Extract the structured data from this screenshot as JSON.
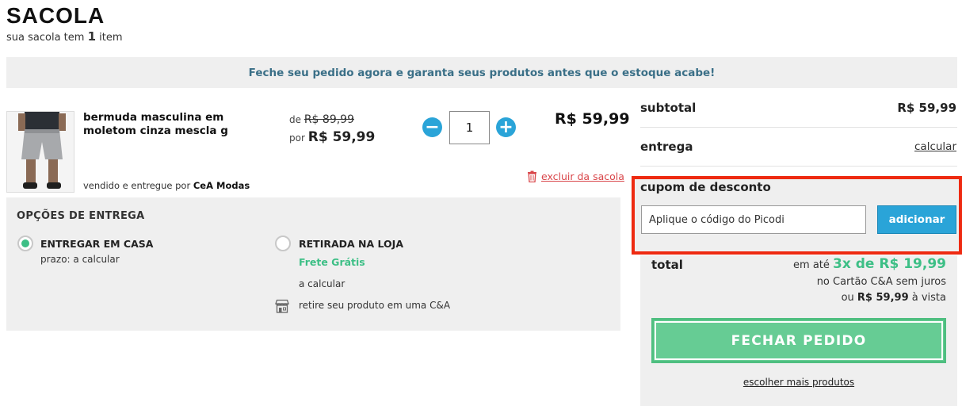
{
  "header": {
    "title": "SACOLA",
    "subtitle_prefix": "sua sacola tem",
    "item_count": "1",
    "subtitle_suffix": "item"
  },
  "banner": {
    "text": "Feche seu pedido agora e garanta seus produtos antes que o estoque acabe!"
  },
  "product": {
    "name": "bermuda masculina em moletom cinza mescla g",
    "price_from_label": "de",
    "price_from": "R$ 89,99",
    "price_by_label": "por",
    "price_by": "R$ 59,99",
    "quantity": "1",
    "quantity_minus": "−",
    "quantity_plus": "+",
    "item_total": "R$ 59,99",
    "seller_prefix": "vendido e entregue por",
    "seller_name": "CeA Modas",
    "remove_label": "excluir da sacola"
  },
  "delivery": {
    "title": "OPÇÕES DE ENTREGA",
    "home": {
      "label": "ENTREGAR EM CASA",
      "prazo": "prazo: a calcular",
      "selected": true
    },
    "store": {
      "label": "RETIRADA NA LOJA",
      "free_shipping": "Frete Grátis",
      "calc": "a calcular",
      "pickup_text": "retire seu produto em uma C&A",
      "selected": false
    }
  },
  "summary": {
    "subtotal_label": "subtotal",
    "subtotal_value": "R$ 59,99",
    "delivery_label": "entrega",
    "delivery_link": "calcular",
    "coupon_label": "cupom de desconto",
    "coupon_value": "Aplique o código do Picodi",
    "coupon_button": "adicionar",
    "total_label": "total",
    "installments_prefix": "em até",
    "installments_value": "3x de R$ 19,99",
    "installments_card": "no Cartão C&A sem juros",
    "cash_prefix": "ou",
    "cash_value": "R$ 59,99",
    "cash_suffix": "à vista",
    "checkout_button": "FECHAR PEDIDO",
    "more_products_link": "escolher mais produtos"
  },
  "colors": {
    "accent_blue": "#2aa4d8",
    "accent_green": "#3dbf86",
    "checkout_green": "#66cc94",
    "banner_text": "#3a6f87",
    "highlight_red": "#ee2a11",
    "remove_red": "#d9464a"
  },
  "icons": [
    "minus-icon",
    "plus-icon",
    "trash-icon",
    "store-icon",
    "radio-icon"
  ]
}
